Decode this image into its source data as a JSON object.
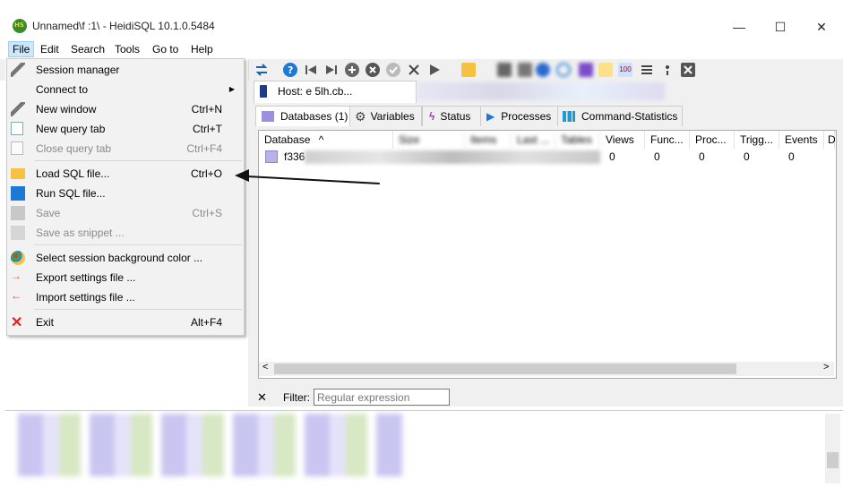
{
  "window": {
    "title": "Unnamed\\f                  :1\\ - HeidiSQL 10.1.0.5484",
    "minimize": "—",
    "maximize": "☐",
    "close": "✕"
  },
  "menubar": {
    "items": [
      "File",
      "Edit",
      "Search",
      "Tools",
      "Go to",
      "Help"
    ]
  },
  "file_menu": {
    "items": [
      {
        "label": "Session manager",
        "shortcut": "",
        "enabled": true,
        "icon": "session-manager-icon"
      },
      {
        "label": "Connect to",
        "shortcut": "",
        "enabled": true,
        "icon": "",
        "submenu_arrow": "▶"
      },
      {
        "label": "New window",
        "shortcut": "Ctrl+N",
        "enabled": true,
        "icon": "new-window-icon"
      },
      {
        "label": "New query tab",
        "shortcut": "Ctrl+T",
        "enabled": true,
        "icon": "new-query-tab-icon"
      },
      {
        "label": "Close query tab",
        "shortcut": "Ctrl+F4",
        "enabled": false,
        "icon": "close-query-tab-icon"
      },
      {
        "label": "Load SQL file...",
        "shortcut": "Ctrl+O",
        "enabled": true,
        "icon": "folder-icon"
      },
      {
        "label": "Run SQL file...",
        "shortcut": "",
        "enabled": true,
        "icon": "run-sql-file-icon"
      },
      {
        "label": "Save",
        "shortcut": "Ctrl+S",
        "enabled": false,
        "icon": "save-icon"
      },
      {
        "label": "Save as snippet ...",
        "shortcut": "",
        "enabled": false,
        "icon": "save-snippet-icon"
      },
      {
        "label": "Select session background color ...",
        "shortcut": "",
        "enabled": true,
        "icon": "palette-icon"
      },
      {
        "label": "Export settings file ...",
        "shortcut": "",
        "enabled": true,
        "icon": "export-icon"
      },
      {
        "label": "Import settings file ...",
        "shortcut": "",
        "enabled": true,
        "icon": "import-icon"
      },
      {
        "label": "Exit",
        "shortcut": "Alt+F4",
        "enabled": true,
        "icon": "exit-icon"
      }
    ]
  },
  "host_tab": {
    "label": "Host: e              5lh.cb..."
  },
  "subtabs": [
    "Databases (1)",
    "Variables",
    "Status",
    "Processes",
    "Command-Statistics"
  ],
  "grid": {
    "columns": [
      "Database",
      "Size",
      "Items",
      "Last ...",
      "Tables",
      "Views",
      "Func...",
      "Proc...",
      "Trigg...",
      "Events",
      "D"
    ],
    "sort_indicator": "^",
    "row": {
      "database": "f336",
      "views": "0",
      "functions": "0",
      "procedures": "0",
      "triggers": "0",
      "events": "0"
    }
  },
  "filter": {
    "close": "✕",
    "label": "Filter:",
    "placeholder": "Regular expression"
  },
  "scroll": {
    "left": "<",
    "right": ">"
  },
  "colors": {
    "accent_selection": "#cce8ff",
    "menu_bg": "#f2f2f2",
    "disabled_text": "#8a8a8a"
  }
}
